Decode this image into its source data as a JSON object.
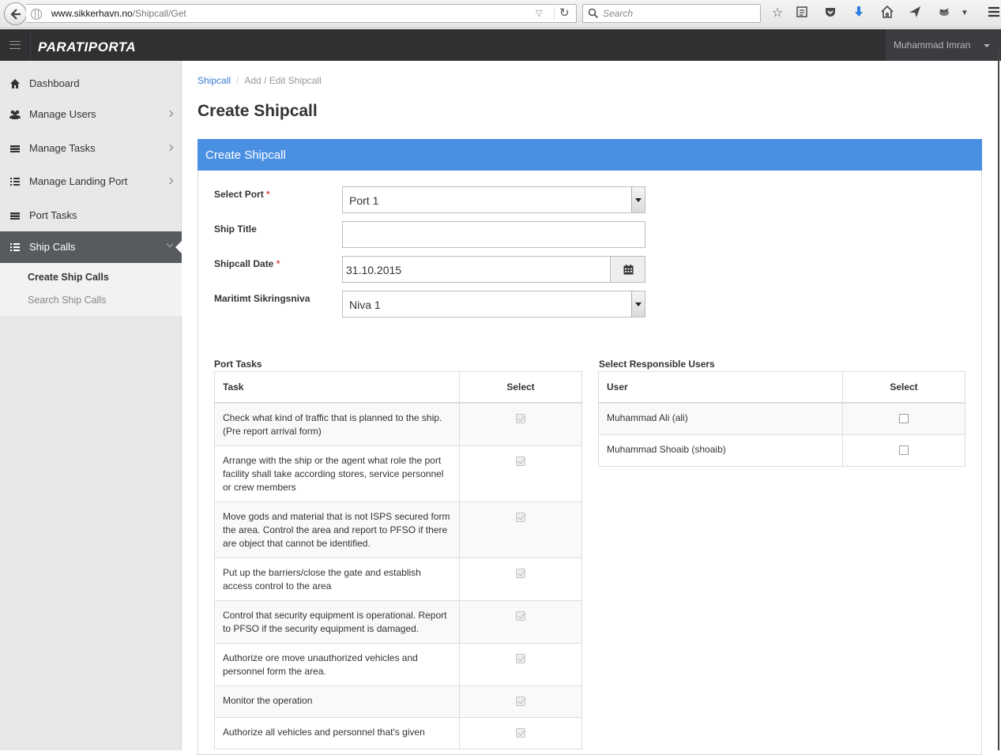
{
  "browser": {
    "url_host": "www.sikkerhavn.no",
    "url_path": "/Shipcall/Get",
    "search_placeholder": "Search"
  },
  "header": {
    "brand": "PARATIPORTA",
    "user_name": "Muhammad Imran"
  },
  "sidebar": {
    "items": [
      {
        "label": "Dashboard",
        "icon": "home-icon"
      },
      {
        "label": "Manage Users",
        "icon": "users-icon"
      },
      {
        "label": "Manage Tasks",
        "icon": "tasks-icon"
      },
      {
        "label": "Manage Landing Port",
        "icon": "list-icon"
      },
      {
        "label": "Port Tasks",
        "icon": "tasks-icon"
      },
      {
        "label": "Ship Calls",
        "icon": "list-icon",
        "active": true
      }
    ],
    "sub_items": [
      {
        "label": "Create Ship Calls",
        "current": true
      },
      {
        "label": "Search Ship Calls",
        "current": false
      }
    ]
  },
  "breadcrumb": {
    "link": "Shipcall",
    "current": "Add / Edit Shipcall"
  },
  "page_title": "Create Shipcall",
  "panel_title": "Create Shipcall",
  "form": {
    "port_label": "Select Port",
    "port_value": "Port 1",
    "ship_title_label": "Ship Title",
    "ship_title_value": "",
    "date_label": "Shipcall Date",
    "date_value": "31.10.2015",
    "level_label": "Maritimt Sikringsniva",
    "level_value": "Niva 1",
    "required_marker": "*"
  },
  "port_tasks": {
    "title": "Port Tasks",
    "col_task": "Task",
    "col_select": "Select",
    "rows": [
      {
        "task": "Check what kind of traffic that is planned to the ship. (Pre report arrival form)",
        "checked": true
      },
      {
        "task": "Arrange with the ship or the agent what role the port facility shall take according stores, service personnel or crew members",
        "checked": true
      },
      {
        "task": "Move gods and material that is not ISPS secured form the area. Control the area and report to PFSO if there are object that cannot be identified.",
        "checked": true
      },
      {
        "task": "Put up the barriers/close the gate and establish access control to the area",
        "checked": true
      },
      {
        "task": "Control that security equipment is operational. Report to PFSO if the security equipment is damaged.",
        "checked": true
      },
      {
        "task": "Authorize ore move unauthorized vehicles and personnel form the area.",
        "checked": true
      },
      {
        "task": "Monitor the operation",
        "checked": true
      },
      {
        "task": "Authorize all vehicles and personnel that's given",
        "checked": true
      }
    ]
  },
  "responsible_users": {
    "title": "Select Responsible Users",
    "col_user": "User",
    "col_select": "Select",
    "rows": [
      {
        "user": "Muhammad Ali (ali)",
        "checked": false
      },
      {
        "user": "Muhammad Shoaib (shoaib)",
        "checked": false
      }
    ]
  }
}
